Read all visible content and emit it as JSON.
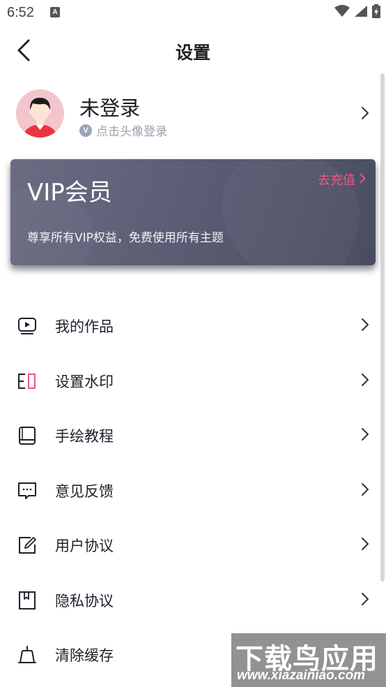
{
  "status_bar": {
    "time": "6:52",
    "notification_icon": "a-notification-icon",
    "icons": [
      "wifi-icon",
      "signal-icon",
      "battery-icon"
    ]
  },
  "header": {
    "title": "设置",
    "back_icon": "back-arrow-icon"
  },
  "profile": {
    "name": "未登录",
    "badge": "V",
    "hint": "点击头像登录"
  },
  "vip": {
    "title": "VIP会员",
    "recharge_label": "去充值",
    "description": "尊享所有VIP权益，免费使用所有主题"
  },
  "menu": {
    "items": [
      {
        "label": "我的作品",
        "icon": "my-works-icon"
      },
      {
        "label": "设置水印",
        "icon": "watermark-icon"
      },
      {
        "label": "手绘教程",
        "icon": "tutorial-book-icon"
      },
      {
        "label": "意见反馈",
        "icon": "feedback-icon"
      },
      {
        "label": "用户协议",
        "icon": "user-agreement-icon"
      },
      {
        "label": "隐私协议",
        "icon": "privacy-agreement-icon"
      },
      {
        "label": "清除缓存",
        "icon": "clear-cache-icon"
      }
    ]
  },
  "watermark": {
    "title": "下载鸟应用",
    "url": "www.xiazainiao.com"
  },
  "colors": {
    "accent_pink": "#f0567f",
    "vip_card": "#5b5e74",
    "text": "#1f1f2b",
    "hint": "#9ba0ab"
  }
}
